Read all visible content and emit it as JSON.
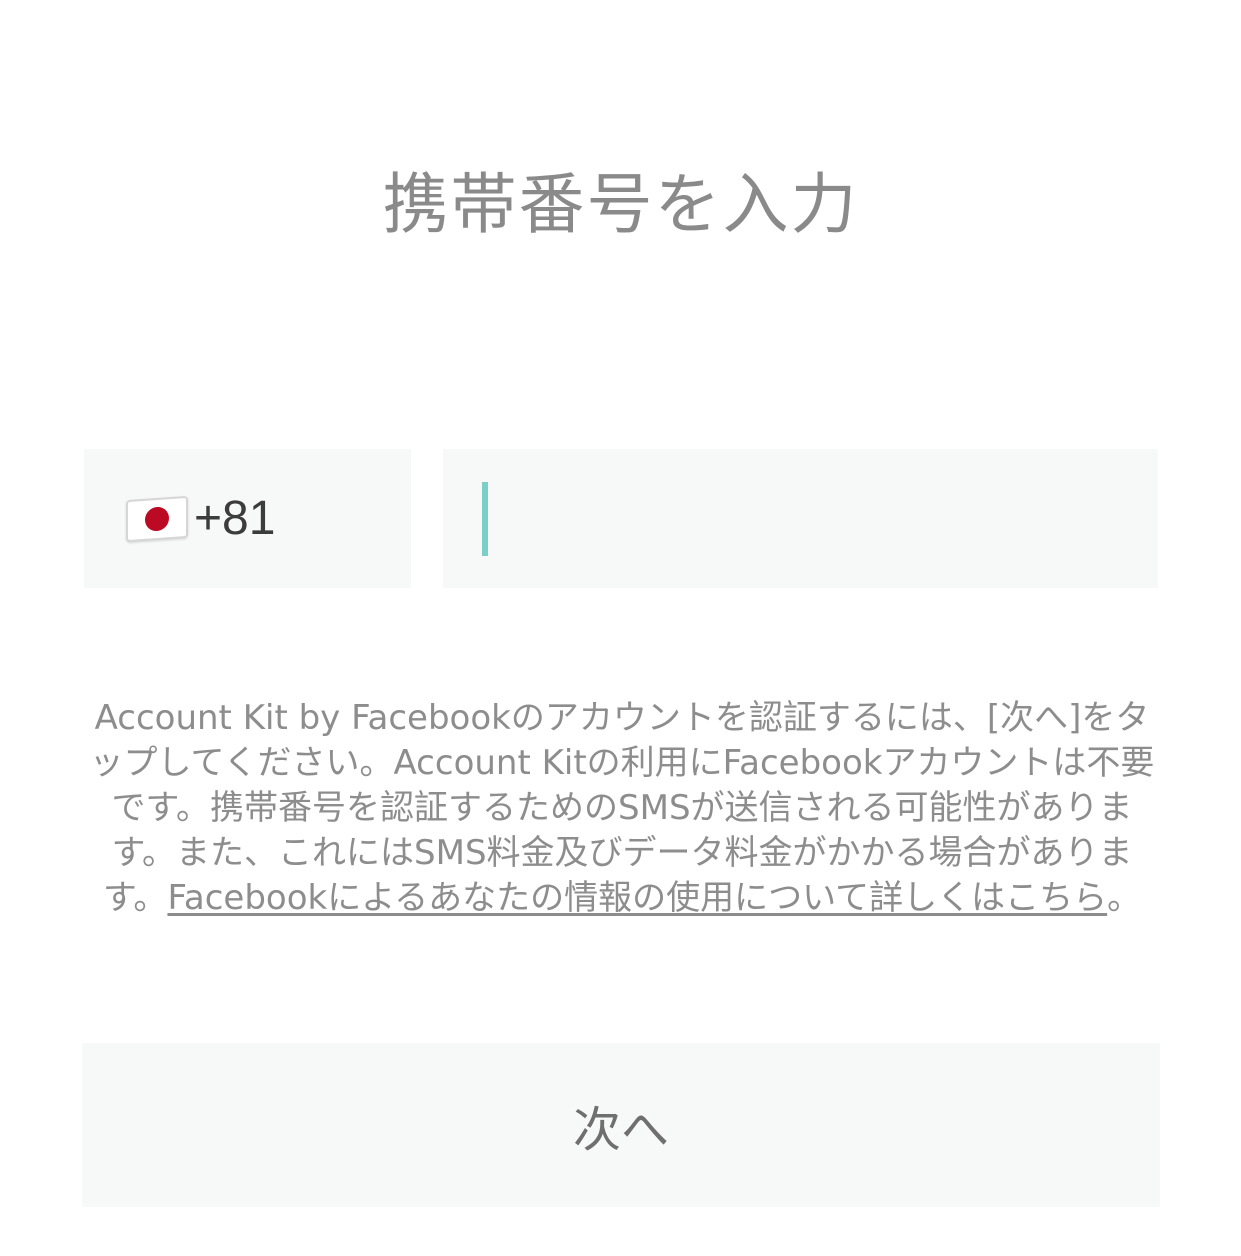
{
  "header": {
    "title": "携帯番号を入力"
  },
  "phone_form": {
    "country": {
      "flag_icon": "japan-flag-icon",
      "dial_code": "+81"
    },
    "phone_number": {
      "value": "",
      "placeholder": ""
    }
  },
  "consent": {
    "text_before_link": "Account Kit by Facebookのアカウントを認証するには、[次へ]をタップしてください。Account Kitの利用にFacebookアカウントは不要です。携帯番号を認証するためのSMSが送信される可能性があります。また、これにはSMS料金及びデータ料金がかかる場合があります。",
    "link_text": "Facebookによるあなたの情報の使用について詳しくはこちら",
    "text_after_link": "。"
  },
  "actions": {
    "next_label": "次へ"
  },
  "colors": {
    "field_background": "#f7f8f8",
    "caret": "#7ccfc8",
    "title_text": "#8a8a8a",
    "body_text": "#8d8d8d",
    "flag_red": "#bc0a24"
  }
}
